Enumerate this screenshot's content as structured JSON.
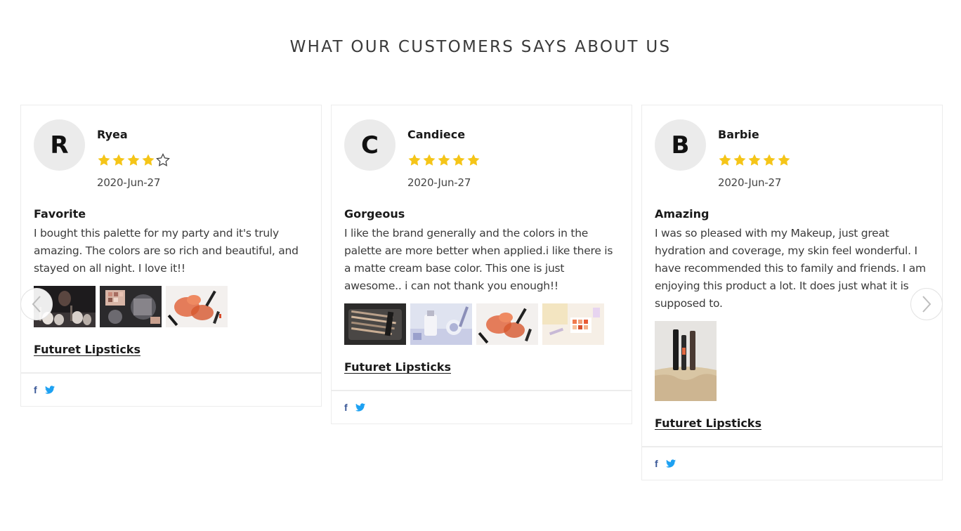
{
  "section": {
    "title": "WHAT OUR CUSTOMERS SAYS ABOUT US"
  },
  "colors": {
    "star_filled": "#f5c518",
    "star_empty_stroke": "#444444",
    "facebook": "#3b5998",
    "twitter": "#1da1f2"
  },
  "reviews": [
    {
      "avatar_letter": "R",
      "name": "Ryea",
      "rating": 4,
      "rating_max": 5,
      "date": "2020-Jun-27",
      "title": "Favorite",
      "text": "I bought this palette for my party and it's truly amazing. The colors are so rich and beautiful, and stayed on all night. I love it!!",
      "photos": [
        "makeup-brushes-photo",
        "eyeshadow-palette-photo",
        "lipsticks-photo"
      ],
      "product": "Futuret Lipsticks",
      "share_icons": [
        "facebook-icon",
        "twitter-icon"
      ]
    },
    {
      "avatar_letter": "C",
      "name": "Candiece",
      "rating": 5,
      "rating_max": 5,
      "date": "2020-Jun-27",
      "title": "Gorgeous",
      "text": "I like the brand generally and the colors in the palette are more better when applied.i like there is a matte cream base color. This one is just awesome.. i can not thank you enough!!",
      "photos": [
        "brush-set-photo",
        "cosmetics-bottles-photo",
        "lipsticks-photo",
        "palette-flatlay-photo"
      ],
      "product": "Futuret Lipsticks",
      "share_icons": [
        "facebook-icon",
        "twitter-icon"
      ]
    },
    {
      "avatar_letter": "B",
      "name": "Barbie",
      "rating": 5,
      "rating_max": 5,
      "date": "2020-Jun-27",
      "title": "Amazing",
      "text": "I was so pleased with my Makeup, just great hydration and coverage, my skin feel wonderful. I have recommended this to family and friends. I am enjoying this product a lot. It does just what it is supposed to.",
      "photos": [
        "mascara-products-photo"
      ],
      "product": "Futuret Lipsticks",
      "share_icons": [
        "facebook-icon",
        "twitter-icon"
      ]
    }
  ],
  "carousel": {
    "prev_icon": "chevron-left-icon",
    "next_icon": "chevron-right-icon"
  }
}
